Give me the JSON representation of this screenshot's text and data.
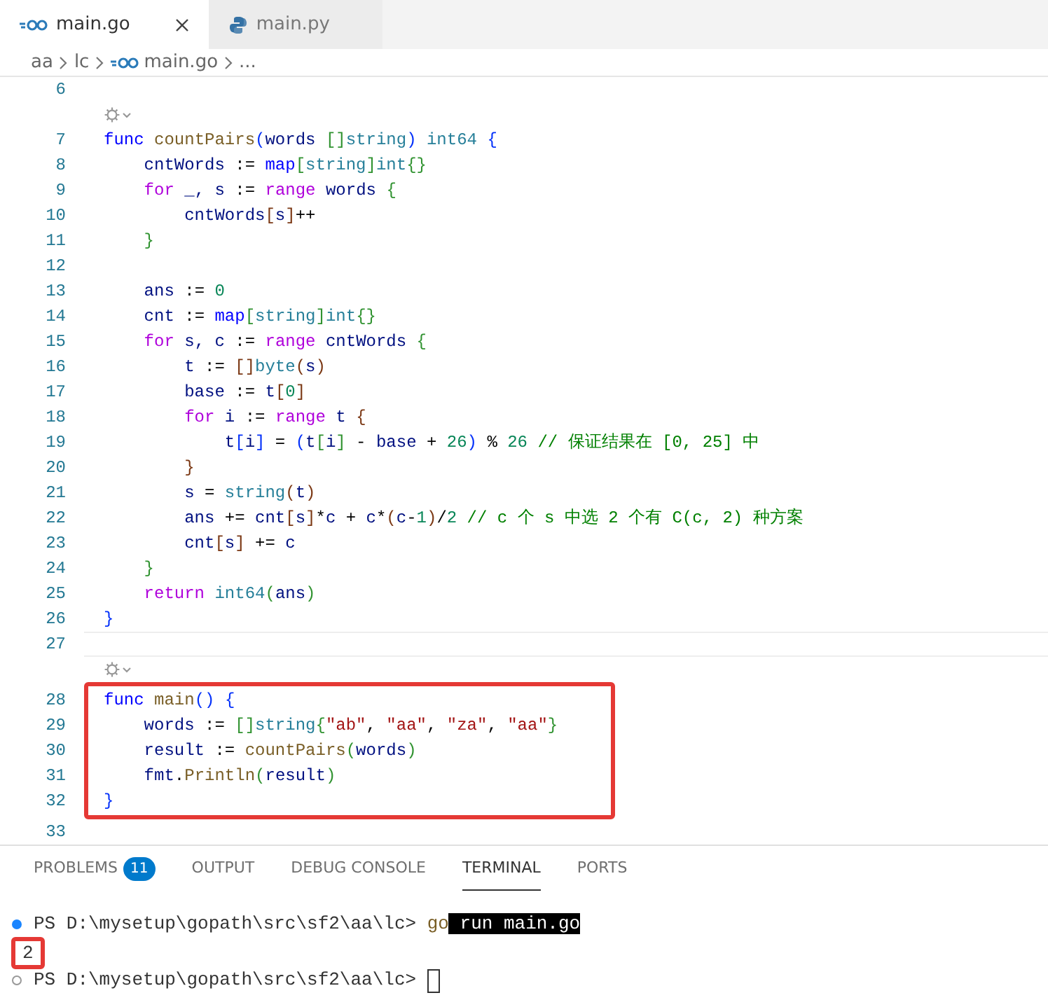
{
  "tabs": [
    {
      "label": "main.go",
      "kind": "go",
      "selected": true
    },
    {
      "label": "main.py",
      "kind": "python",
      "selected": false
    }
  ],
  "breadcrumb": [
    {
      "text": "aa",
      "kind": "folder"
    },
    {
      "text": "lc",
      "kind": "folder"
    },
    {
      "text": "main.go",
      "kind": "go"
    },
    {
      "text": "...",
      "kind": "symbol"
    }
  ],
  "editor": {
    "blocks": [
      {
        "kind": "plain",
        "rows": [
          {
            "kind": "code",
            "number": "6",
            "tokens": []
          },
          {
            "kind": "codelens"
          },
          {
            "kind": "code",
            "number": "7",
            "tokens": [
              {
                "text": "func ",
                "kind": "decl"
              },
              {
                "text": "countPairs",
                "kind": "function"
              },
              {
                "text": "(",
                "kind": "level1"
              },
              {
                "text": "words ",
                "kind": "variable"
              },
              {
                "text": "[]",
                "kind": "level2"
              },
              {
                "text": "string",
                "kind": "type"
              },
              {
                "text": ") ",
                "kind": "level1"
              },
              {
                "text": "int64 ",
                "kind": "type"
              },
              {
                "text": "{",
                "kind": "level1"
              }
            ]
          },
          {
            "kind": "code",
            "number": "8",
            "tokens": [
              {
                "text": "    cntWords",
                "kind": "variable"
              },
              {
                "text": " := ",
                "kind": "plain"
              },
              {
                "text": "map",
                "kind": "decl"
              },
              {
                "text": "[",
                "kind": "level2"
              },
              {
                "text": "string",
                "kind": "type"
              },
              {
                "text": "]",
                "kind": "level2"
              },
              {
                "text": "int",
                "kind": "type"
              },
              {
                "text": "{}",
                "kind": "level2"
              }
            ]
          },
          {
            "kind": "code",
            "number": "9",
            "tokens": [
              {
                "text": "    for",
                "kind": "control"
              },
              {
                "text": " _, s",
                "kind": "variable"
              },
              {
                "text": " := ",
                "kind": "plain"
              },
              {
                "text": "range",
                "kind": "control"
              },
              {
                "text": " words ",
                "kind": "variable"
              },
              {
                "text": "{",
                "kind": "level2"
              }
            ]
          },
          {
            "kind": "code",
            "number": "10",
            "tokens": [
              {
                "text": "        cntWords",
                "kind": "variable"
              },
              {
                "text": "[",
                "kind": "level3"
              },
              {
                "text": "s",
                "kind": "variable"
              },
              {
                "text": "]",
                "kind": "level3"
              },
              {
                "text": "++",
                "kind": "plain"
              }
            ]
          },
          {
            "kind": "code",
            "number": "11",
            "tokens": [
              {
                "text": "    }",
                "kind": "level2"
              }
            ]
          },
          {
            "kind": "code",
            "number": "12",
            "tokens": []
          },
          {
            "kind": "code",
            "number": "13",
            "tokens": [
              {
                "text": "    ans",
                "kind": "variable"
              },
              {
                "text": " := ",
                "kind": "plain"
              },
              {
                "text": "0",
                "kind": "number"
              }
            ]
          },
          {
            "kind": "code",
            "number": "14",
            "tokens": [
              {
                "text": "    cnt",
                "kind": "variable"
              },
              {
                "text": " := ",
                "kind": "plain"
              },
              {
                "text": "map",
                "kind": "decl"
              },
              {
                "text": "[",
                "kind": "level2"
              },
              {
                "text": "string",
                "kind": "type"
              },
              {
                "text": "]",
                "kind": "level2"
              },
              {
                "text": "int",
                "kind": "type"
              },
              {
                "text": "{}",
                "kind": "level2"
              }
            ]
          },
          {
            "kind": "code",
            "number": "15",
            "tokens": [
              {
                "text": "    for",
                "kind": "control"
              },
              {
                "text": " s, c",
                "kind": "variable"
              },
              {
                "text": " := ",
                "kind": "plain"
              },
              {
                "text": "range",
                "kind": "control"
              },
              {
                "text": " cntWords ",
                "kind": "variable"
              },
              {
                "text": "{",
                "kind": "level2"
              }
            ]
          },
          {
            "kind": "code",
            "number": "16",
            "tokens": [
              {
                "text": "        t",
                "kind": "variable"
              },
              {
                "text": " := ",
                "kind": "plain"
              },
              {
                "text": "[]",
                "kind": "level3"
              },
              {
                "text": "byte",
                "kind": "type"
              },
              {
                "text": "(",
                "kind": "level3"
              },
              {
                "text": "s",
                "kind": "variable"
              },
              {
                "text": ")",
                "kind": "level3"
              }
            ]
          },
          {
            "kind": "code",
            "number": "17",
            "tokens": [
              {
                "text": "        base",
                "kind": "variable"
              },
              {
                "text": " := ",
                "kind": "plain"
              },
              {
                "text": "t",
                "kind": "variable"
              },
              {
                "text": "[",
                "kind": "level3"
              },
              {
                "text": "0",
                "kind": "number"
              },
              {
                "text": "]",
                "kind": "level3"
              }
            ]
          },
          {
            "kind": "code",
            "number": "18",
            "tokens": [
              {
                "text": "        for",
                "kind": "control"
              },
              {
                "text": " i",
                "kind": "variable"
              },
              {
                "text": " := ",
                "kind": "plain"
              },
              {
                "text": "range",
                "kind": "control"
              },
              {
                "text": " t ",
                "kind": "variable"
              },
              {
                "text": "{",
                "kind": "level3"
              }
            ]
          },
          {
            "kind": "code",
            "number": "19",
            "tokens": [
              {
                "text": "            t",
                "kind": "variable"
              },
              {
                "text": "[",
                "kind": "level1"
              },
              {
                "text": "i",
                "kind": "variable"
              },
              {
                "text": "]",
                "kind": "level1"
              },
              {
                "text": " = ",
                "kind": "plain"
              },
              {
                "text": "(",
                "kind": "level1"
              },
              {
                "text": "t",
                "kind": "variable"
              },
              {
                "text": "[",
                "kind": "level2"
              },
              {
                "text": "i",
                "kind": "variable"
              },
              {
                "text": "]",
                "kind": "level2"
              },
              {
                "text": " - ",
                "kind": "plain"
              },
              {
                "text": "base",
                "kind": "variable"
              },
              {
                "text": " + ",
                "kind": "plain"
              },
              {
                "text": "26",
                "kind": "number"
              },
              {
                "text": ")",
                "kind": "level1"
              },
              {
                "text": " % ",
                "kind": "plain"
              },
              {
                "text": "26",
                "kind": "number"
              },
              {
                "text": " // 保证结果在 [0, 25] 中",
                "kind": "comment"
              }
            ]
          },
          {
            "kind": "code",
            "number": "20",
            "tokens": [
              {
                "text": "        }",
                "kind": "level3"
              }
            ]
          },
          {
            "kind": "code",
            "number": "21",
            "tokens": [
              {
                "text": "        s",
                "kind": "variable"
              },
              {
                "text": " = ",
                "kind": "plain"
              },
              {
                "text": "string",
                "kind": "type"
              },
              {
                "text": "(",
                "kind": "level3"
              },
              {
                "text": "t",
                "kind": "variable"
              },
              {
                "text": ")",
                "kind": "level3"
              }
            ]
          },
          {
            "kind": "code",
            "number": "22",
            "tokens": [
              {
                "text": "        ans",
                "kind": "variable"
              },
              {
                "text": " += ",
                "kind": "plain"
              },
              {
                "text": "cnt",
                "kind": "variable"
              },
              {
                "text": "[",
                "kind": "level3"
              },
              {
                "text": "s",
                "kind": "variable"
              },
              {
                "text": "]",
                "kind": "level3"
              },
              {
                "text": "*",
                "kind": "plain"
              },
              {
                "text": "c",
                "kind": "variable"
              },
              {
                "text": " + ",
                "kind": "plain"
              },
              {
                "text": "c",
                "kind": "variable"
              },
              {
                "text": "*",
                "kind": "plain"
              },
              {
                "text": "(",
                "kind": "level3"
              },
              {
                "text": "c",
                "kind": "variable"
              },
              {
                "text": "-",
                "kind": "plain"
              },
              {
                "text": "1",
                "kind": "number"
              },
              {
                "text": ")",
                "kind": "level3"
              },
              {
                "text": "/",
                "kind": "plain"
              },
              {
                "text": "2",
                "kind": "number"
              },
              {
                "text": " // c 个 s 中选 2 个有 C(c, 2) 种方案",
                "kind": "comment"
              }
            ]
          },
          {
            "kind": "code",
            "number": "23",
            "tokens": [
              {
                "text": "        cnt",
                "kind": "variable"
              },
              {
                "text": "[",
                "kind": "level3"
              },
              {
                "text": "s",
                "kind": "variable"
              },
              {
                "text": "]",
                "kind": "level3"
              },
              {
                "text": " += ",
                "kind": "plain"
              },
              {
                "text": "c",
                "kind": "variable"
              }
            ]
          },
          {
            "kind": "code",
            "number": "24",
            "tokens": [
              {
                "text": "    }",
                "kind": "level2"
              }
            ]
          },
          {
            "kind": "code",
            "number": "25",
            "tokens": [
              {
                "text": "    return ",
                "kind": "control"
              },
              {
                "text": "int64",
                "kind": "type"
              },
              {
                "text": "(",
                "kind": "level2"
              },
              {
                "text": "ans",
                "kind": "variable"
              },
              {
                "text": ")",
                "kind": "level2"
              }
            ]
          },
          {
            "kind": "code",
            "number": "26",
            "tokens": [
              {
                "text": "}",
                "kind": "level1"
              }
            ]
          },
          {
            "kind": "current",
            "number": "27",
            "tokens": []
          },
          {
            "kind": "codelens"
          }
        ]
      },
      {
        "kind": "framed",
        "rows": [
          {
            "kind": "code",
            "number": "28",
            "tokens": [
              {
                "text": "func ",
                "kind": "decl"
              },
              {
                "text": "main",
                "kind": "function"
              },
              {
                "text": "() ",
                "kind": "level1"
              },
              {
                "text": "{",
                "kind": "level1"
              }
            ]
          },
          {
            "kind": "code",
            "number": "29",
            "tokens": [
              {
                "text": "    words",
                "kind": "variable"
              },
              {
                "text": " := ",
                "kind": "plain"
              },
              {
                "text": "[]",
                "kind": "level2"
              },
              {
                "text": "string",
                "kind": "type"
              },
              {
                "text": "{",
                "kind": "level2"
              },
              {
                "text": "\"ab\"",
                "kind": "string"
              },
              {
                "text": ", ",
                "kind": "plain"
              },
              {
                "text": "\"aa\"",
                "kind": "string"
              },
              {
                "text": ", ",
                "kind": "plain"
              },
              {
                "text": "\"za\"",
                "kind": "string"
              },
              {
                "text": ", ",
                "kind": "plain"
              },
              {
                "text": "\"aa\"",
                "kind": "string"
              },
              {
                "text": "}",
                "kind": "level2"
              }
            ]
          },
          {
            "kind": "code",
            "number": "30",
            "tokens": [
              {
                "text": "    result",
                "kind": "variable"
              },
              {
                "text": " := ",
                "kind": "plain"
              },
              {
                "text": "countPairs",
                "kind": "function"
              },
              {
                "text": "(",
                "kind": "level2"
              },
              {
                "text": "words",
                "kind": "variable"
              },
              {
                "text": ")",
                "kind": "level2"
              }
            ]
          },
          {
            "kind": "code",
            "number": "31",
            "tokens": [
              {
                "text": "    fmt",
                "kind": "variable"
              },
              {
                "text": ".",
                "kind": "plain"
              },
              {
                "text": "Println",
                "kind": "function"
              },
              {
                "text": "(",
                "kind": "level2"
              },
              {
                "text": "result",
                "kind": "variable"
              },
              {
                "text": ")",
                "kind": "level2"
              }
            ]
          },
          {
            "kind": "code",
            "number": "32",
            "tokens": [
              {
                "text": "}",
                "kind": "level1"
              }
            ]
          }
        ]
      },
      {
        "kind": "plain",
        "rows": [
          {
            "kind": "code",
            "number": "33",
            "tokens": []
          }
        ]
      }
    ]
  },
  "panel": {
    "tabs": [
      {
        "label": "PROBLEMS",
        "badge": "11",
        "selected": false
      },
      {
        "label": "OUTPUT",
        "selected": false
      },
      {
        "label": "DEBUG CONSOLE",
        "selected": false
      },
      {
        "label": "TERMINAL",
        "selected": true
      },
      {
        "label": "PORTS",
        "selected": false
      }
    ],
    "terminal": [
      {
        "kind": "finished",
        "prompt": "PS D:\\mysetup\\gopath\\src\\sf2\\aa\\lc>",
        "command": [
          {
            "text": "go",
            "selected": false
          },
          {
            "text": "run main.go",
            "selected": true
          }
        ]
      },
      {
        "kind": "framed-output",
        "text": "2"
      },
      {
        "kind": "waiting",
        "prompt": "PS D:\\mysetup\\gopath\\src\\sf2\\aa\\lc>"
      }
    ]
  }
}
